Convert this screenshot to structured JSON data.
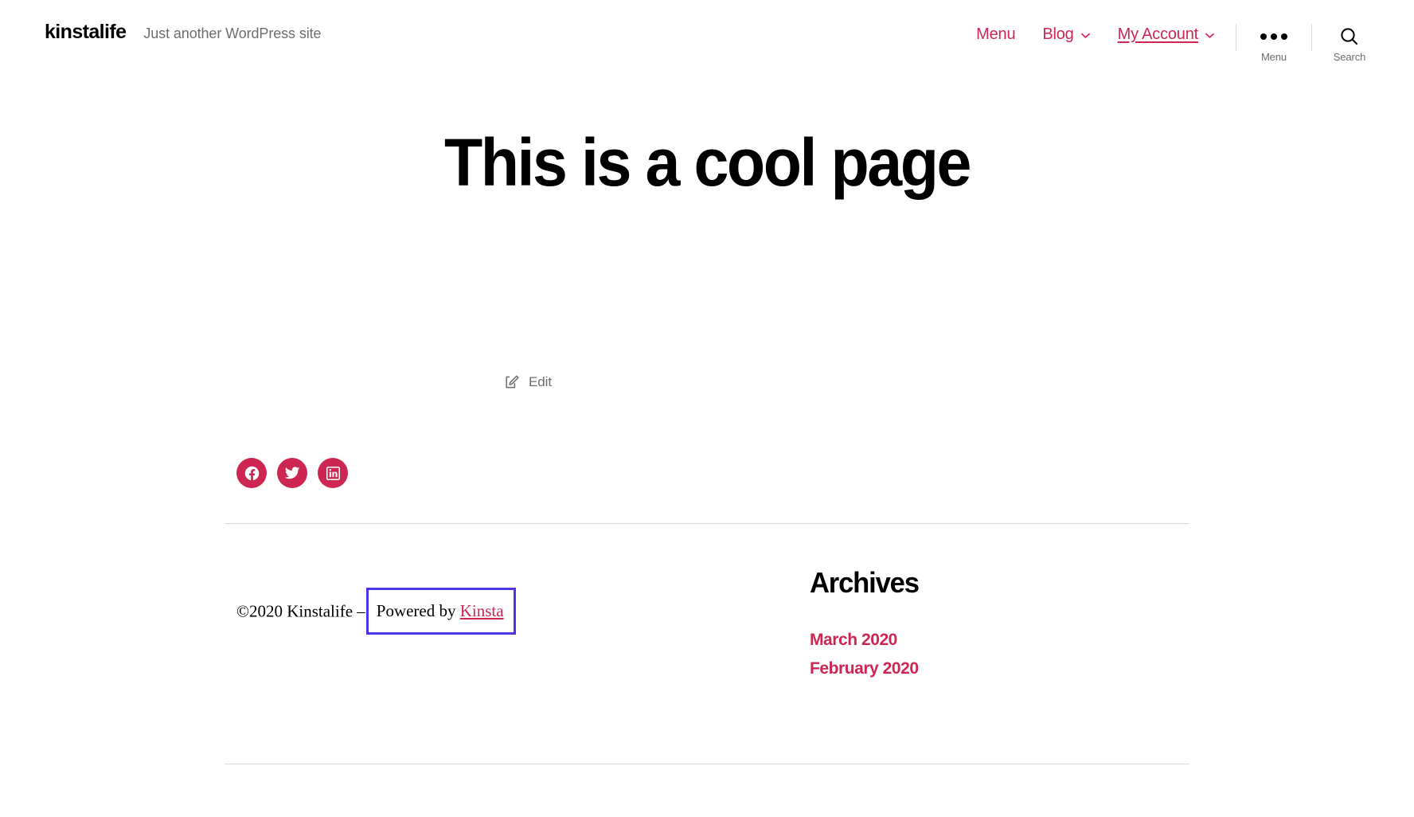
{
  "site": {
    "title": "kinstalife",
    "description": "Just another WordPress site",
    "accent_color": "#cd2653",
    "text_color": "#000000",
    "muted_color": "#6d6d6d",
    "rule_color": "#dedad4",
    "highlight_box_color": "#4b35e8"
  },
  "header": {
    "nav": [
      {
        "label": "Menu",
        "icon": "",
        "has_chevron": false,
        "underlined": false
      },
      {
        "label": "Blog",
        "icon": "chevron-down-icon",
        "has_chevron": true,
        "underlined": false
      },
      {
        "label": "My Account",
        "icon": "chevron-down-icon",
        "has_chevron": true,
        "underlined": true
      }
    ],
    "menu_toggle": {
      "label": "Menu",
      "icon": "ellipsis-icon"
    },
    "search_toggle": {
      "label": "Search",
      "icon": "search-icon"
    }
  },
  "main": {
    "page_title": "This is a cool page",
    "edit": {
      "label": "Edit",
      "icon": "edit-pencil-icon"
    },
    "social": [
      {
        "name": "Facebook",
        "icon": "facebook-icon"
      },
      {
        "name": "Twitter",
        "icon": "twitter-icon"
      },
      {
        "name": "LinkedIn",
        "icon": "linkedin-icon"
      }
    ]
  },
  "footer": {
    "copyright": "©2020 Kinstalife",
    "separator": "–",
    "powered_by_prefix": "Powered by",
    "powered_by_link": "Kinsta",
    "widget": {
      "title": "Archives",
      "items": [
        {
          "label": "March 2020"
        },
        {
          "label": "February 2020"
        }
      ]
    }
  }
}
